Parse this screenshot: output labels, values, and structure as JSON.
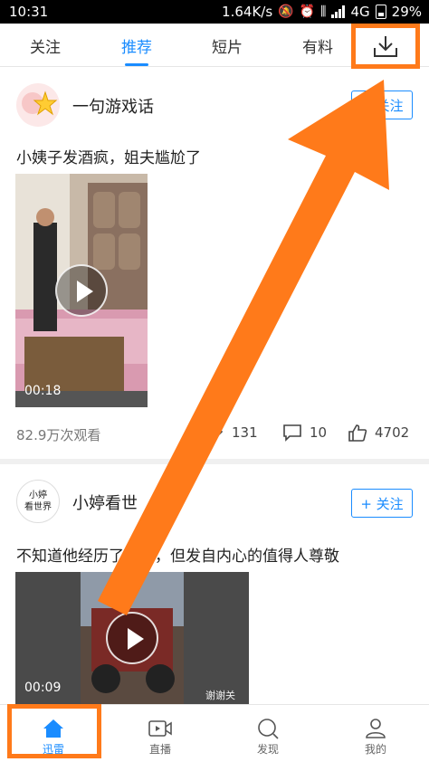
{
  "status_bar": {
    "time": "10:31",
    "network_speed": "1.64K/s",
    "network_type": "4G",
    "battery": "29%"
  },
  "top_tabs": {
    "items": [
      {
        "label": "关注"
      },
      {
        "label": "推荐"
      },
      {
        "label": "短片"
      },
      {
        "label": "有料"
      }
    ],
    "active": "推荐",
    "download_icon": "download-icon"
  },
  "posts": [
    {
      "author": "一句游戏话",
      "follow_label": "+ 关注",
      "title": "小姨子发酒疯，姐夫尴尬了",
      "duration": "00:18",
      "views": "82.9万次观看",
      "shares": "131",
      "comments": "10",
      "likes": "4702"
    },
    {
      "author": "小婷看世",
      "avatar_text_1": "小婷",
      "avatar_text_2": "看世界",
      "follow_label": "+ 关注",
      "title": "不知道他经历了什么，但发自内心的值得人尊敬",
      "duration": "00:09",
      "watermark": "谢谢关注！"
    }
  ],
  "bottom_nav": {
    "items": [
      {
        "label": "迅雷"
      },
      {
        "label": "直播"
      },
      {
        "label": "发现"
      },
      {
        "label": "我的"
      }
    ]
  },
  "colors": {
    "accent": "#1a8cff",
    "highlight": "#ff7a1a"
  }
}
